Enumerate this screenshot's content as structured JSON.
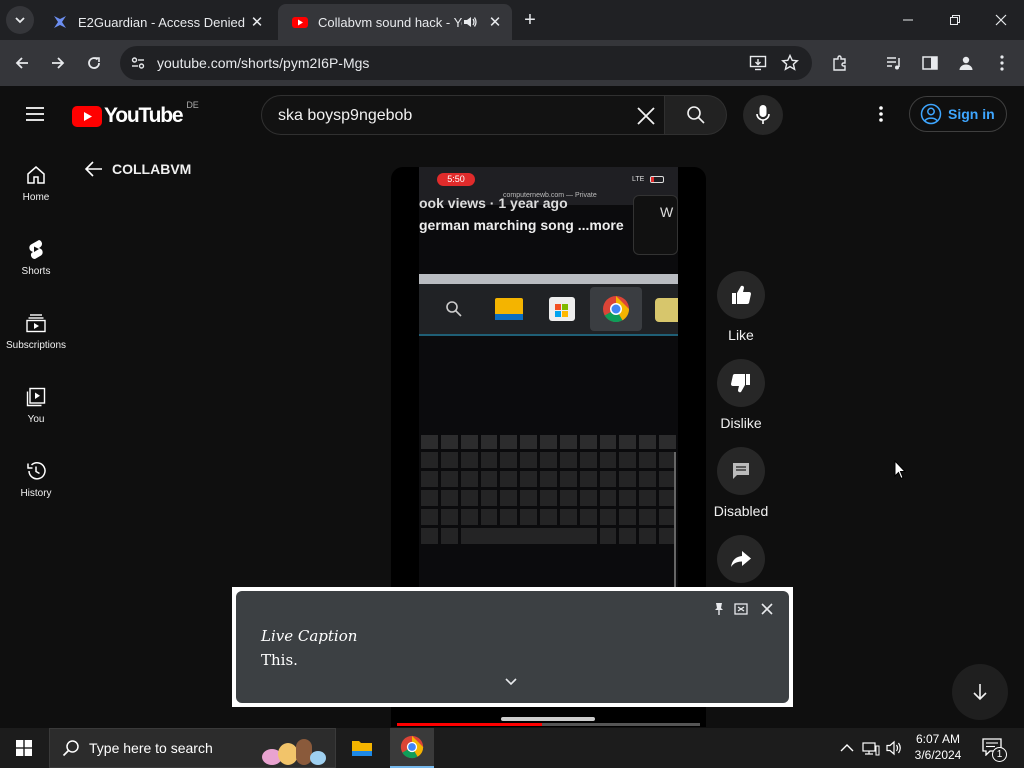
{
  "browser": {
    "tabs": [
      {
        "title": "E2Guardian - Access Denied",
        "active": false
      },
      {
        "title": "Collabvm sound hack - You",
        "active": true
      }
    ],
    "url": "youtube.com/shorts/pym2I6P-Mgs"
  },
  "youtube": {
    "logo_text": "YouTube",
    "region": "DE",
    "search_query": "ska boysp9ngebob",
    "sign_in_label": "Sign in",
    "channel_back_label": "COLLABVM",
    "sidebar": [
      {
        "label": "Home",
        "icon": "home-icon"
      },
      {
        "label": "Shorts",
        "icon": "shorts-icon"
      },
      {
        "label": "Subscriptions",
        "icon": "subscriptions-icon"
      },
      {
        "label": "You",
        "icon": "you-icon"
      },
      {
        "label": "History",
        "icon": "history-icon"
      }
    ],
    "actions": [
      {
        "label": "Like",
        "icon": "thumbs-up-icon"
      },
      {
        "label": "Dislike",
        "icon": "thumbs-down-icon"
      },
      {
        "label": "Disabled",
        "icon": "comments-icon"
      },
      {
        "label": "",
        "icon": "share-icon"
      }
    ]
  },
  "video": {
    "phone_time": "5:50",
    "phone_url": "computernewb.com — Private",
    "phone_signal": "LTE",
    "line1": "ook views · 1 year ago",
    "line2": "german marching song ...more",
    "side_letter": "W"
  },
  "live_caption": {
    "title": "Live Caption",
    "text": "This."
  },
  "taskbar": {
    "search_placeholder": "Type here to search",
    "time": "6:07 AM",
    "date": "3/6/2024",
    "notification_count": "1"
  },
  "colors": {
    "youtube_red": "#ff0000",
    "link_blue": "#3ea6ff",
    "chrome_dark": "#202124",
    "chrome_toolbar": "#35363a"
  }
}
